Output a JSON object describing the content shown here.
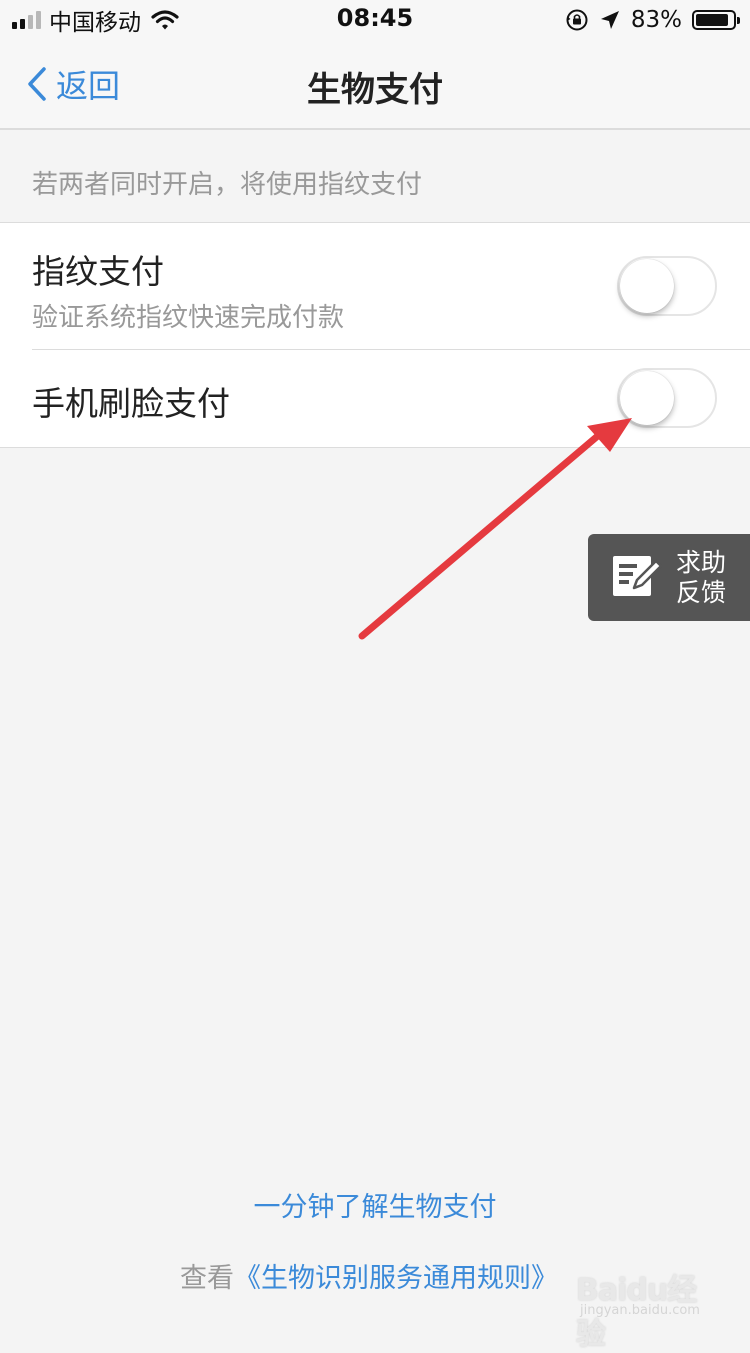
{
  "status_bar": {
    "carrier": "中国移动",
    "time": "08:45",
    "battery_percent": "83%",
    "battery_level": 0.83,
    "signal_bars_filled": 2,
    "signal_bars_total": 4
  },
  "nav": {
    "back_label": "返回",
    "title": "生物支付"
  },
  "hint": "若两者同时开启，将使用指纹支付",
  "settings": [
    {
      "title": "指纹支付",
      "subtitle": "验证系统指纹快速完成付款",
      "enabled": false
    },
    {
      "title": "手机刷脸支付",
      "enabled": false
    }
  ],
  "help_feedback": {
    "line1": "求助",
    "line2": "反馈"
  },
  "footer": {
    "learn_link": "一分钟了解生物支付",
    "rules_prefix": "查看",
    "rules_link": "《生物识别服务通用规则》"
  },
  "watermark": {
    "text": "Baidu经验",
    "sub": "jingyan.baidu.com"
  },
  "colors": {
    "accent": "#3b8ad9",
    "annotation_arrow": "#e53a3f",
    "background": "#f4f4f4"
  }
}
